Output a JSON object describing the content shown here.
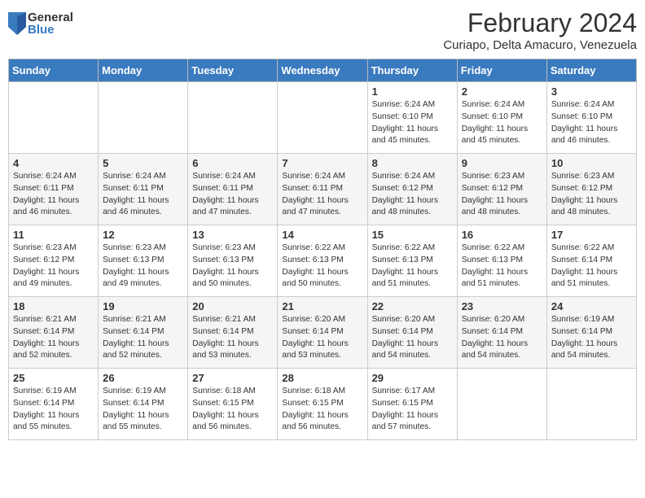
{
  "header": {
    "title": "February 2024",
    "location": "Curiapo, Delta Amacuro, Venezuela",
    "logo_general": "General",
    "logo_blue": "Blue"
  },
  "days_of_week": [
    "Sunday",
    "Monday",
    "Tuesday",
    "Wednesday",
    "Thursday",
    "Friday",
    "Saturday"
  ],
  "weeks": [
    [
      {
        "day": "",
        "info": ""
      },
      {
        "day": "",
        "info": ""
      },
      {
        "day": "",
        "info": ""
      },
      {
        "day": "",
        "info": ""
      },
      {
        "day": "1",
        "info": "Sunrise: 6:24 AM\nSunset: 6:10 PM\nDaylight: 11 hours\nand 45 minutes."
      },
      {
        "day": "2",
        "info": "Sunrise: 6:24 AM\nSunset: 6:10 PM\nDaylight: 11 hours\nand 45 minutes."
      },
      {
        "day": "3",
        "info": "Sunrise: 6:24 AM\nSunset: 6:10 PM\nDaylight: 11 hours\nand 46 minutes."
      }
    ],
    [
      {
        "day": "4",
        "info": "Sunrise: 6:24 AM\nSunset: 6:11 PM\nDaylight: 11 hours\nand 46 minutes."
      },
      {
        "day": "5",
        "info": "Sunrise: 6:24 AM\nSunset: 6:11 PM\nDaylight: 11 hours\nand 46 minutes."
      },
      {
        "day": "6",
        "info": "Sunrise: 6:24 AM\nSunset: 6:11 PM\nDaylight: 11 hours\nand 47 minutes."
      },
      {
        "day": "7",
        "info": "Sunrise: 6:24 AM\nSunset: 6:11 PM\nDaylight: 11 hours\nand 47 minutes."
      },
      {
        "day": "8",
        "info": "Sunrise: 6:24 AM\nSunset: 6:12 PM\nDaylight: 11 hours\nand 48 minutes."
      },
      {
        "day": "9",
        "info": "Sunrise: 6:23 AM\nSunset: 6:12 PM\nDaylight: 11 hours\nand 48 minutes."
      },
      {
        "day": "10",
        "info": "Sunrise: 6:23 AM\nSunset: 6:12 PM\nDaylight: 11 hours\nand 48 minutes."
      }
    ],
    [
      {
        "day": "11",
        "info": "Sunrise: 6:23 AM\nSunset: 6:12 PM\nDaylight: 11 hours\nand 49 minutes."
      },
      {
        "day": "12",
        "info": "Sunrise: 6:23 AM\nSunset: 6:13 PM\nDaylight: 11 hours\nand 49 minutes."
      },
      {
        "day": "13",
        "info": "Sunrise: 6:23 AM\nSunset: 6:13 PM\nDaylight: 11 hours\nand 50 minutes."
      },
      {
        "day": "14",
        "info": "Sunrise: 6:22 AM\nSunset: 6:13 PM\nDaylight: 11 hours\nand 50 minutes."
      },
      {
        "day": "15",
        "info": "Sunrise: 6:22 AM\nSunset: 6:13 PM\nDaylight: 11 hours\nand 51 minutes."
      },
      {
        "day": "16",
        "info": "Sunrise: 6:22 AM\nSunset: 6:13 PM\nDaylight: 11 hours\nand 51 minutes."
      },
      {
        "day": "17",
        "info": "Sunrise: 6:22 AM\nSunset: 6:14 PM\nDaylight: 11 hours\nand 51 minutes."
      }
    ],
    [
      {
        "day": "18",
        "info": "Sunrise: 6:21 AM\nSunset: 6:14 PM\nDaylight: 11 hours\nand 52 minutes."
      },
      {
        "day": "19",
        "info": "Sunrise: 6:21 AM\nSunset: 6:14 PM\nDaylight: 11 hours\nand 52 minutes."
      },
      {
        "day": "20",
        "info": "Sunrise: 6:21 AM\nSunset: 6:14 PM\nDaylight: 11 hours\nand 53 minutes."
      },
      {
        "day": "21",
        "info": "Sunrise: 6:20 AM\nSunset: 6:14 PM\nDaylight: 11 hours\nand 53 minutes."
      },
      {
        "day": "22",
        "info": "Sunrise: 6:20 AM\nSunset: 6:14 PM\nDaylight: 11 hours\nand 54 minutes."
      },
      {
        "day": "23",
        "info": "Sunrise: 6:20 AM\nSunset: 6:14 PM\nDaylight: 11 hours\nand 54 minutes."
      },
      {
        "day": "24",
        "info": "Sunrise: 6:19 AM\nSunset: 6:14 PM\nDaylight: 11 hours\nand 54 minutes."
      }
    ],
    [
      {
        "day": "25",
        "info": "Sunrise: 6:19 AM\nSunset: 6:14 PM\nDaylight: 11 hours\nand 55 minutes."
      },
      {
        "day": "26",
        "info": "Sunrise: 6:19 AM\nSunset: 6:14 PM\nDaylight: 11 hours\nand 55 minutes."
      },
      {
        "day": "27",
        "info": "Sunrise: 6:18 AM\nSunset: 6:15 PM\nDaylight: 11 hours\nand 56 minutes."
      },
      {
        "day": "28",
        "info": "Sunrise: 6:18 AM\nSunset: 6:15 PM\nDaylight: 11 hours\nand 56 minutes."
      },
      {
        "day": "29",
        "info": "Sunrise: 6:17 AM\nSunset: 6:15 PM\nDaylight: 11 hours\nand 57 minutes."
      },
      {
        "day": "",
        "info": ""
      },
      {
        "day": "",
        "info": ""
      }
    ]
  ]
}
